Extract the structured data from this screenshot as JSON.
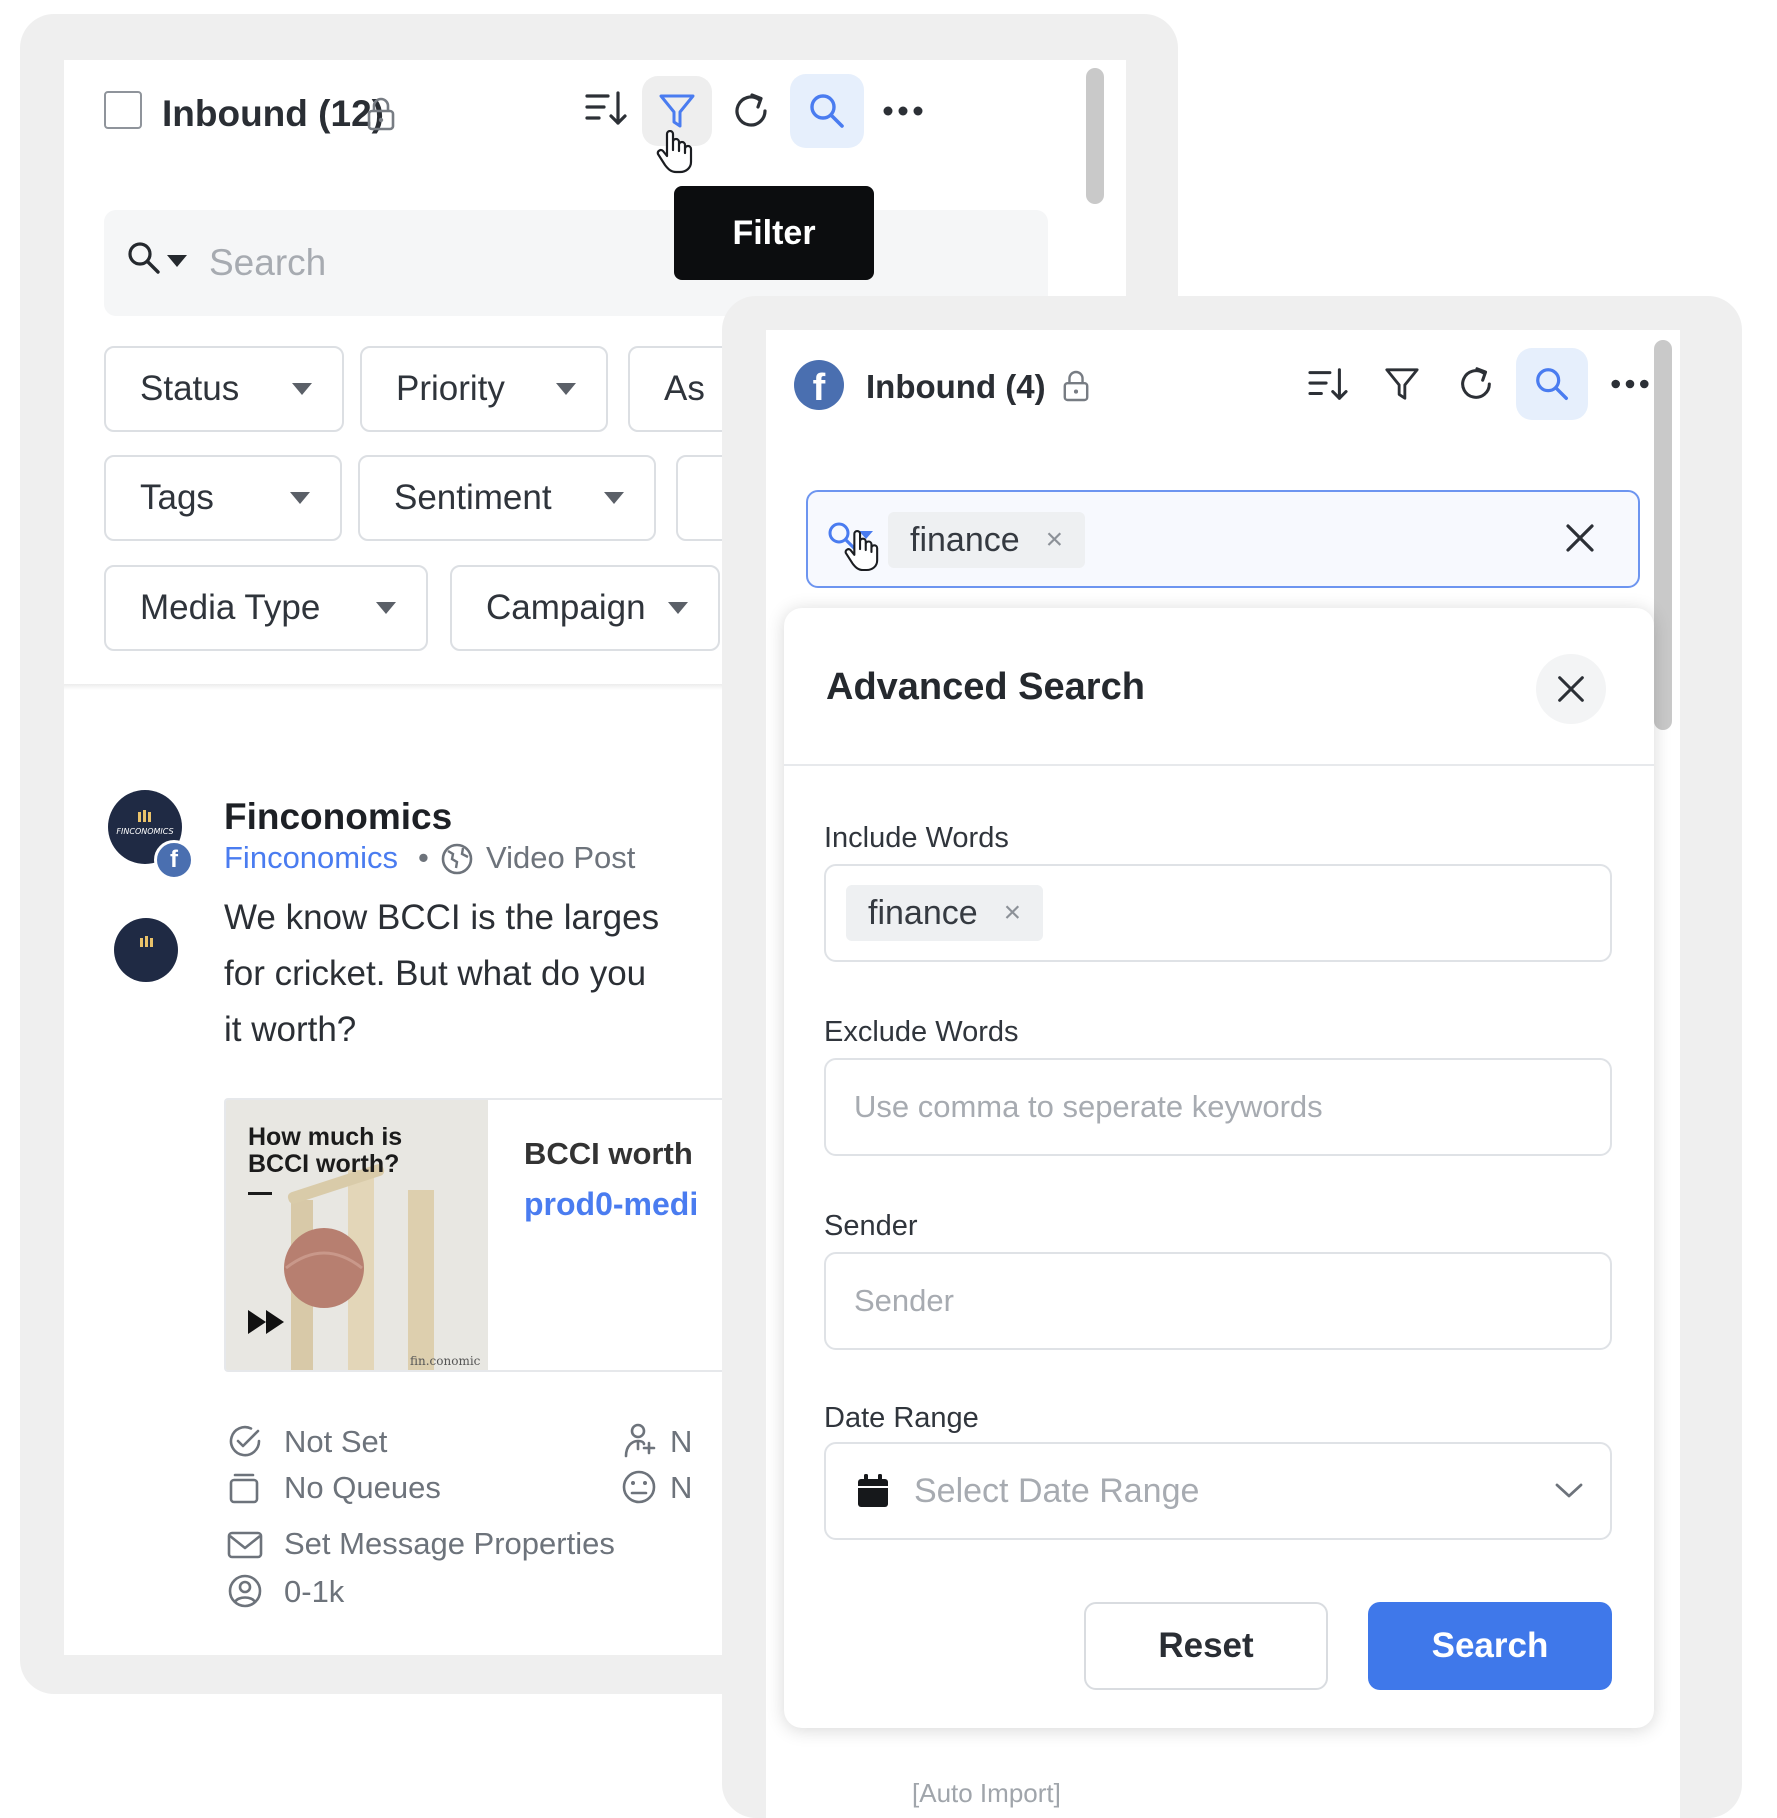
{
  "left_panel": {
    "title": "Inbound (12)",
    "tooltip": "Filter",
    "search_placeholder": "Search",
    "filter_chips": [
      "Status",
      "Priority",
      "As",
      "Tags",
      "Sentiment",
      "Media Type",
      "Campaign"
    ],
    "post": {
      "author": "Finconomics",
      "account": "Finconomics",
      "separator": "•",
      "post_type": "Video Post",
      "text_lines": [
        "We know BCCI is the larges",
        "for cricket. But what do you",
        "it worth?"
      ],
      "thumbnail_caption_line1": "How much is",
      "thumbnail_caption_line2": "BCCI worth?",
      "thumbnail_watermark": "fin.conomic",
      "link_title": "BCCI worth",
      "link_url": "prod0-medi",
      "meta": {
        "status": "Not Set",
        "assignee": "N",
        "queues": "No Queues",
        "sentiment": "N",
        "properties": "Set Message Properties",
        "followers": "0-1k"
      }
    }
  },
  "right_panel": {
    "title": "Inbound (4)",
    "search_tag": "finance",
    "advanced_search": {
      "title": "Advanced Search",
      "include_label": "Include Words",
      "include_tag": "finance",
      "exclude_label": "Exclude Words",
      "exclude_placeholder": "Use comma to seperate keywords",
      "sender_label": "Sender",
      "sender_placeholder": "Sender",
      "date_label": "Date Range",
      "date_placeholder": "Select Date Range",
      "reset_label": "Reset",
      "search_label": "Search"
    },
    "underlying_text": "[Auto Import]"
  },
  "colors": {
    "accent": "#3f78ea",
    "link": "#4a7cf0",
    "active_bg": "#e6effc",
    "tooltip_bg": "#0c0d0f"
  }
}
